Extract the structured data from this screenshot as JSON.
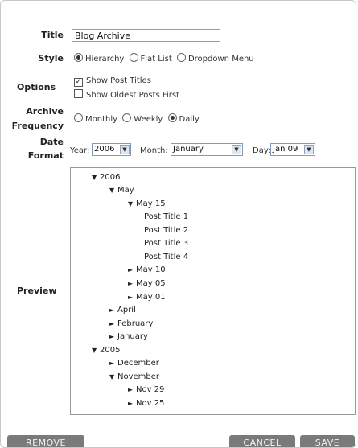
{
  "form": {
    "title_label": "Title",
    "title_value": "Blog Archive",
    "style_label": "Style",
    "style_options": [
      "Hierarchy",
      "Flat List",
      "Dropdown Menu"
    ],
    "style_selected": "Hierarchy",
    "options_label": "Options",
    "options": [
      {
        "label": "Show Post Titles",
        "checked": true
      },
      {
        "label": "Show Oldest Posts First",
        "checked": false
      }
    ],
    "frequency_label_1": "Archive",
    "frequency_label_2": "Frequency",
    "frequency_options": [
      "Monthly",
      "Weekly",
      "Daily"
    ],
    "frequency_selected": "Daily",
    "date_label_1": "Date",
    "date_label_2": "Format",
    "year_label": "Year:",
    "year_value": "2006",
    "month_label": "Month:",
    "month_value": "January",
    "day_label": "Day:",
    "day_value": "Jan 09",
    "preview_label": "Preview"
  },
  "preview": {
    "y2006": "2006",
    "may": "May",
    "may15": "May 15",
    "post1": "Post Title 1",
    "post2": "Post Title 2",
    "post3": "Post Title 3",
    "post4": "Post Title 4",
    "may10": "May 10",
    "may05": "May 05",
    "may01": "May 01",
    "april": "April",
    "february": "February",
    "january": "January",
    "y2005": "2005",
    "december": "December",
    "november": "November",
    "nov29": "Nov 29",
    "nov25": "Nov 25"
  },
  "buttons": {
    "remove": "REMOVE",
    "cancel": "CANCEL",
    "save": "SAVE"
  }
}
